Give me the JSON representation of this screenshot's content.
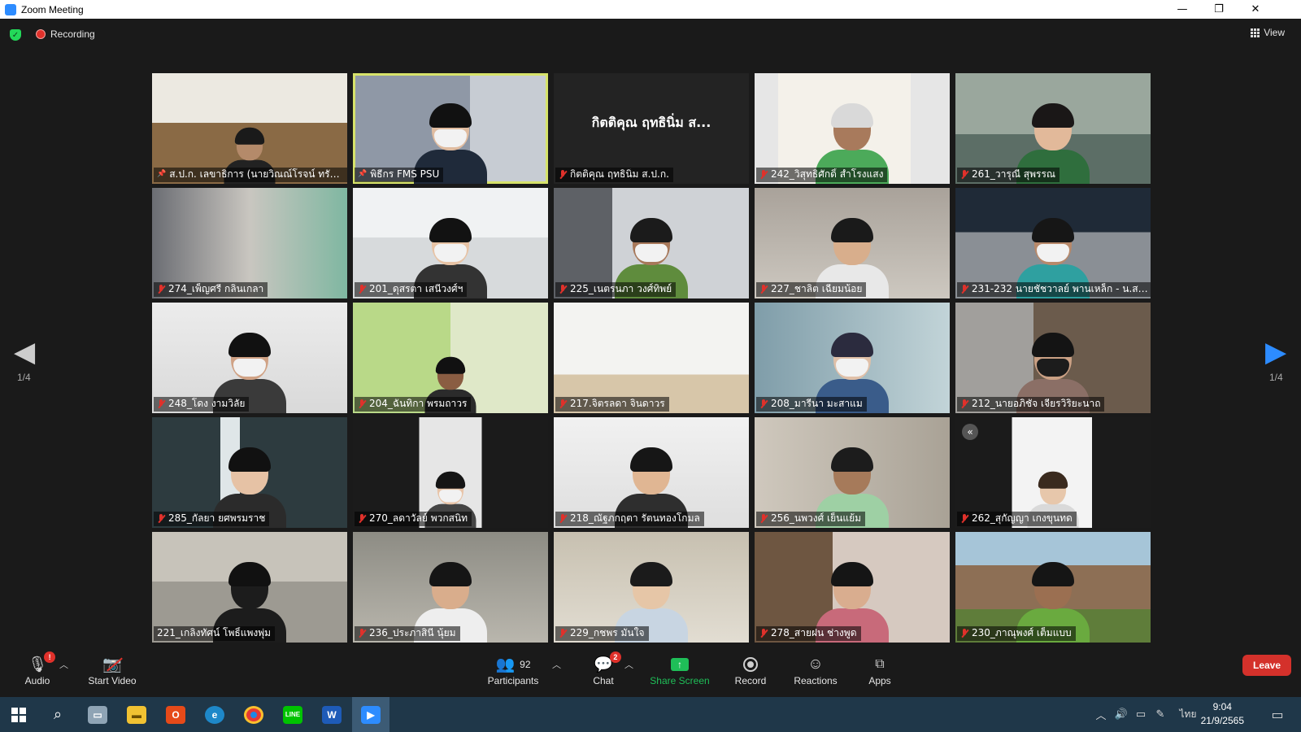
{
  "window": {
    "title": "Zoom Meeting",
    "minimize": "—",
    "restore": "❐",
    "close": "✕"
  },
  "top": {
    "recording_label": "Recording",
    "view_label": "View"
  },
  "pager": {
    "indicator": "1/4"
  },
  "tiles": [
    {
      "name": "ส.ป.ก. เลขาธิการ (นายวิณณ์โรจน์ ทรัพย์ส...",
      "muted": false,
      "pinned": true
    },
    {
      "name": "พิธีกร FMS PSU",
      "muted": false,
      "pinned": true,
      "active": true
    },
    {
      "name": "กิตติคุณ ฤทธินิ่ม ส.ป.ก.",
      "muted": true,
      "big_name": "กิตติคุณ ฤทธินิ่ม ส..."
    },
    {
      "name": "242_วิสุทธิศักดิ์ สำโรงแสง",
      "muted": true
    },
    {
      "name": "261_วารุณี สุพรรณ",
      "muted": true
    },
    {
      "name": "274_เพ็ญศรี กลิ่นเกลา",
      "muted": true
    },
    {
      "name": "201_ดุสรตา เสนีวงศ์ฯ",
      "muted": true
    },
    {
      "name": "225_เนตรนภา วงศ์ทิพย์",
      "muted": true
    },
    {
      "name": "227_ชาลิต เฉียมน้อย",
      "muted": true
    },
    {
      "name": "231-232 นายชัชวาลย์ พานเหล็ก - น.ส....",
      "muted": true
    },
    {
      "name": "248_โดง งามวิลัย",
      "muted": true
    },
    {
      "name": "204_ฉันทิกา พรมถาวร",
      "muted": true
    },
    {
      "name": "217.จิตรลดา จินดาวร",
      "muted": true
    },
    {
      "name": "208_มารีนา มะสาแม",
      "muted": true
    },
    {
      "name": "212_นายอภิชัจ เจียรวิริยะนาถ",
      "muted": true
    },
    {
      "name": "285_กัลยา ยศพรมราช",
      "muted": true
    },
    {
      "name": "270_ลดาวัลย์ พวกสนิท",
      "muted": true
    },
    {
      "name": "218_ณัฐภกฤตา รัตนทองโกมล",
      "muted": true
    },
    {
      "name": "256_นพวงศ์ เย็นแย้ม",
      "muted": true
    },
    {
      "name": "262_สุกัญญา เกงขุนทด",
      "muted": true
    },
    {
      "name": "221_เกลิงทัศน์ โพธิ์แพงพุ่ม",
      "muted": false
    },
    {
      "name": "236_ประภาสินี นุ้ยม",
      "muted": true
    },
    {
      "name": "229_กชพร มั่นใจ",
      "muted": true
    },
    {
      "name": "278_สายฝน ช่างพูด",
      "muted": true
    },
    {
      "name": "230_ภาณุพงศ์ เต็มแบบ",
      "muted": true
    }
  ],
  "controls": {
    "audio_label": "Audio",
    "audio_badge": "!",
    "video_label": "Start Video",
    "participants_label": "Participants",
    "participants_count": "92",
    "chat_label": "Chat",
    "chat_badge": "2",
    "share_label": "Share Screen",
    "record_label": "Record",
    "reactions_label": "Reactions",
    "apps_label": "Apps",
    "leave_label": "Leave"
  },
  "taskbar": {
    "language": "ไทย",
    "time": "9:04",
    "date": "21/9/2565"
  },
  "colors": {
    "accent_green": "#1fbf58",
    "leave_red": "#d4312b",
    "active_speaker": "#d7e36a",
    "zoom_blue": "#2d8cff",
    "taskbar": "#1f3749"
  }
}
